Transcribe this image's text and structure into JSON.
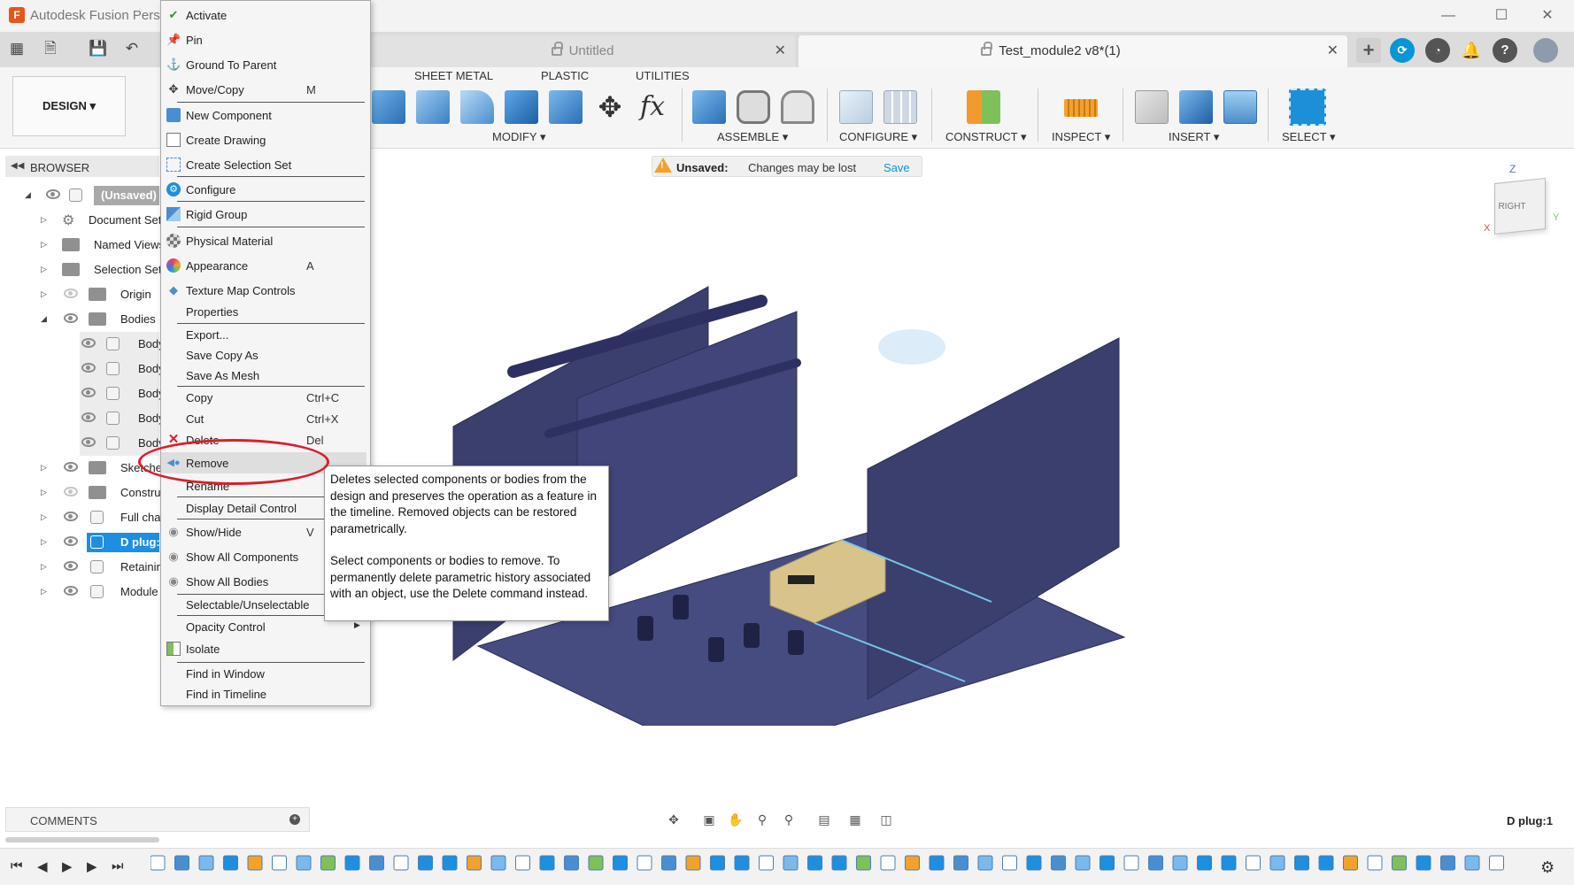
{
  "window": {
    "title": "Autodesk Fusion Personal"
  },
  "tabs": [
    {
      "label": "Untitled"
    },
    {
      "label": "Test_module2 v8*(1)"
    }
  ],
  "toolbar": {
    "workspace": "DESIGN",
    "tabs": [
      "SHEET METAL",
      "PLASTIC",
      "UTILITIES"
    ],
    "groups": [
      "MODIFY",
      "ASSEMBLE",
      "CONFIGURE",
      "CONSTRUCT",
      "INSPECT",
      "INSERT",
      "SELECT"
    ]
  },
  "browser": {
    "title": "BROWSER",
    "items": [
      {
        "label": "(Unsaved)"
      },
      {
        "label": "Document Set"
      },
      {
        "label": "Named Views"
      },
      {
        "label": "Selection Set"
      },
      {
        "label": "Origin"
      },
      {
        "label": "Bodies"
      },
      {
        "label": "Body"
      },
      {
        "label": "Body"
      },
      {
        "label": "Body"
      },
      {
        "label": "Body"
      },
      {
        "label": "Body"
      },
      {
        "label": "Sketche"
      },
      {
        "label": "Constru"
      },
      {
        "label": "Full cha"
      },
      {
        "label": "D plug:"
      },
      {
        "label": "Retainin"
      },
      {
        "label": "Module"
      }
    ]
  },
  "warning": {
    "title": "Unsaved:",
    "message": "Changes may be lost",
    "action": "Save"
  },
  "context_menu": {
    "items": [
      {
        "label": "Activate",
        "shortcut": ""
      },
      {
        "label": "Pin",
        "shortcut": ""
      },
      {
        "label": "Ground To Parent",
        "shortcut": ""
      },
      {
        "label": "Move/Copy",
        "shortcut": "M"
      },
      {
        "label": "New Component",
        "shortcut": ""
      },
      {
        "label": "Create Drawing",
        "shortcut": ""
      },
      {
        "label": "Create Selection Set",
        "shortcut": ""
      },
      {
        "label": "Configure",
        "shortcut": ""
      },
      {
        "label": "Rigid Group",
        "shortcut": ""
      },
      {
        "label": "Physical Material",
        "shortcut": ""
      },
      {
        "label": "Appearance",
        "shortcut": "A"
      },
      {
        "label": "Texture Map Controls",
        "shortcut": ""
      },
      {
        "label": "Properties",
        "shortcut": ""
      },
      {
        "label": "Export...",
        "shortcut": ""
      },
      {
        "label": "Save Copy As",
        "shortcut": ""
      },
      {
        "label": "Save As Mesh",
        "shortcut": ""
      },
      {
        "label": "Copy",
        "shortcut": "Ctrl+C"
      },
      {
        "label": "Cut",
        "shortcut": "Ctrl+X"
      },
      {
        "label": "Delete",
        "shortcut": "Del"
      },
      {
        "label": "Remove",
        "shortcut": ""
      },
      {
        "label": "Rename",
        "shortcut": ""
      },
      {
        "label": "Display Detail Control",
        "shortcut": ""
      },
      {
        "label": "Show/Hide",
        "shortcut": "V"
      },
      {
        "label": "Show All Components",
        "shortcut": ""
      },
      {
        "label": "Show All Bodies",
        "shortcut": ""
      },
      {
        "label": "Selectable/Unselectable",
        "shortcut": ""
      },
      {
        "label": "Opacity Control",
        "shortcut": ""
      },
      {
        "label": "Isolate",
        "shortcut": ""
      },
      {
        "label": "Find in Window",
        "shortcut": ""
      },
      {
        "label": "Find in Timeline",
        "shortcut": ""
      }
    ]
  },
  "tooltip": {
    "p1": "Deletes selected components or bodies from the design and preserves the operation as a feature in the timeline. Removed objects can be restored parametrically.",
    "p2": "Select components or bodies to remove. To permanently delete parametric history associated with an object, use the Delete command instead."
  },
  "viewcube": {
    "face": "RIGHT",
    "z": "Z",
    "x": "X",
    "y": "Y"
  },
  "comments": {
    "label": "COMMENTS"
  },
  "status": {
    "selection": "D plug:1"
  },
  "colors": {
    "accent": "#0696d7",
    "model": "#3b3f6e",
    "warning": "#f2a22b",
    "highlight": "#d9202a"
  }
}
